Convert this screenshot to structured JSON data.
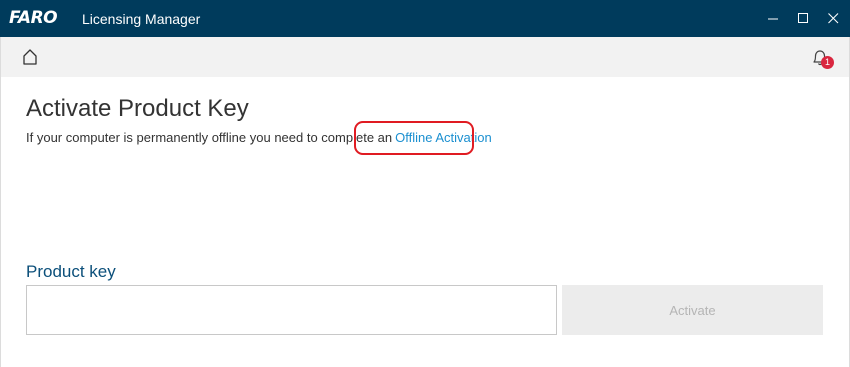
{
  "window": {
    "logo_text": "FARO",
    "title": "Licensing Manager"
  },
  "toolbar": {
    "home_icon": "home-icon",
    "bell_icon": "bell-icon",
    "notification_count": "1"
  },
  "main": {
    "heading": "Activate Product Key",
    "description": "If your computer is permanently offline you need to complete an",
    "offline_link": "Offline Activation",
    "product_key_label": "Product key",
    "product_key_value": "",
    "activate_button": "Activate"
  },
  "colors": {
    "titlebar": "#003b5c",
    "link": "#1a8fd0",
    "badge": "#d9263f",
    "highlight": "#e01b22",
    "label": "#0b4f7a"
  }
}
